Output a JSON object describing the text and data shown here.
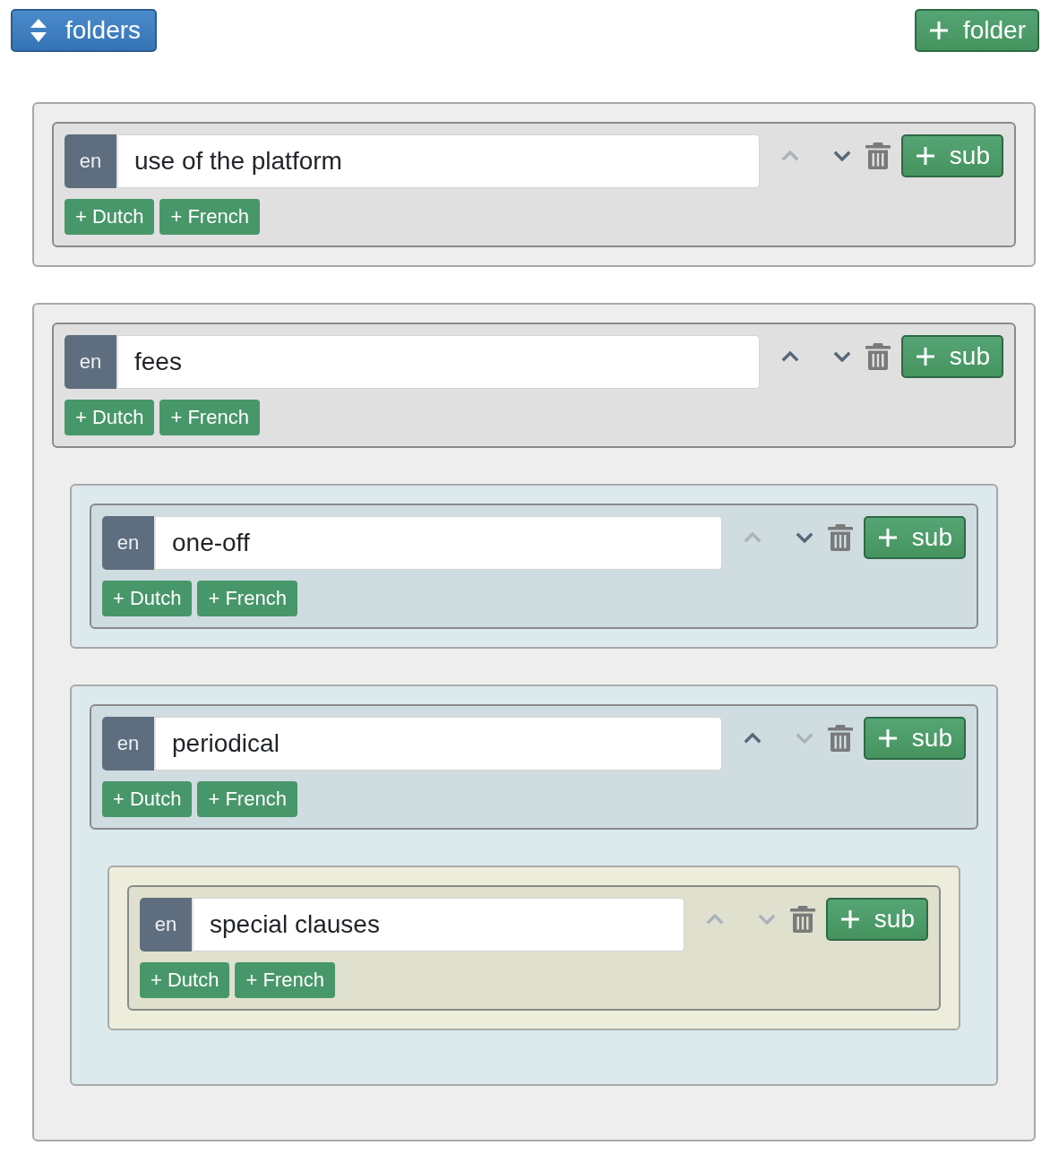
{
  "toolbar": {
    "folders_button": "folders",
    "add_folder_button": "folder"
  },
  "folders": [
    {
      "language": "en",
      "title": "use of the platform",
      "up_disabled": true,
      "down_disabled": false,
      "add_sub_button": "sub",
      "translations": [
        "+ Dutch",
        "+ French"
      ]
    },
    {
      "language": "en",
      "title": "fees",
      "up_disabled": false,
      "down_disabled": false,
      "add_sub_button": "sub",
      "translations": [
        "+ Dutch",
        "+ French"
      ],
      "children": [
        {
          "language": "en",
          "title": "one-off",
          "up_disabled": true,
          "down_disabled": false,
          "add_sub_button": "sub",
          "translations": [
            "+ Dutch",
            "+ French"
          ]
        },
        {
          "language": "en",
          "title": "periodical",
          "up_disabled": false,
          "down_disabled": true,
          "add_sub_button": "sub",
          "translations": [
            "+ Dutch",
            "+ French"
          ],
          "children": [
            {
              "language": "en",
              "title": "special clauses",
              "up_disabled": true,
              "down_disabled": true,
              "add_sub_button": "sub",
              "translations": [
                "+ Dutch",
                "+ French"
              ]
            }
          ]
        }
      ]
    }
  ]
}
